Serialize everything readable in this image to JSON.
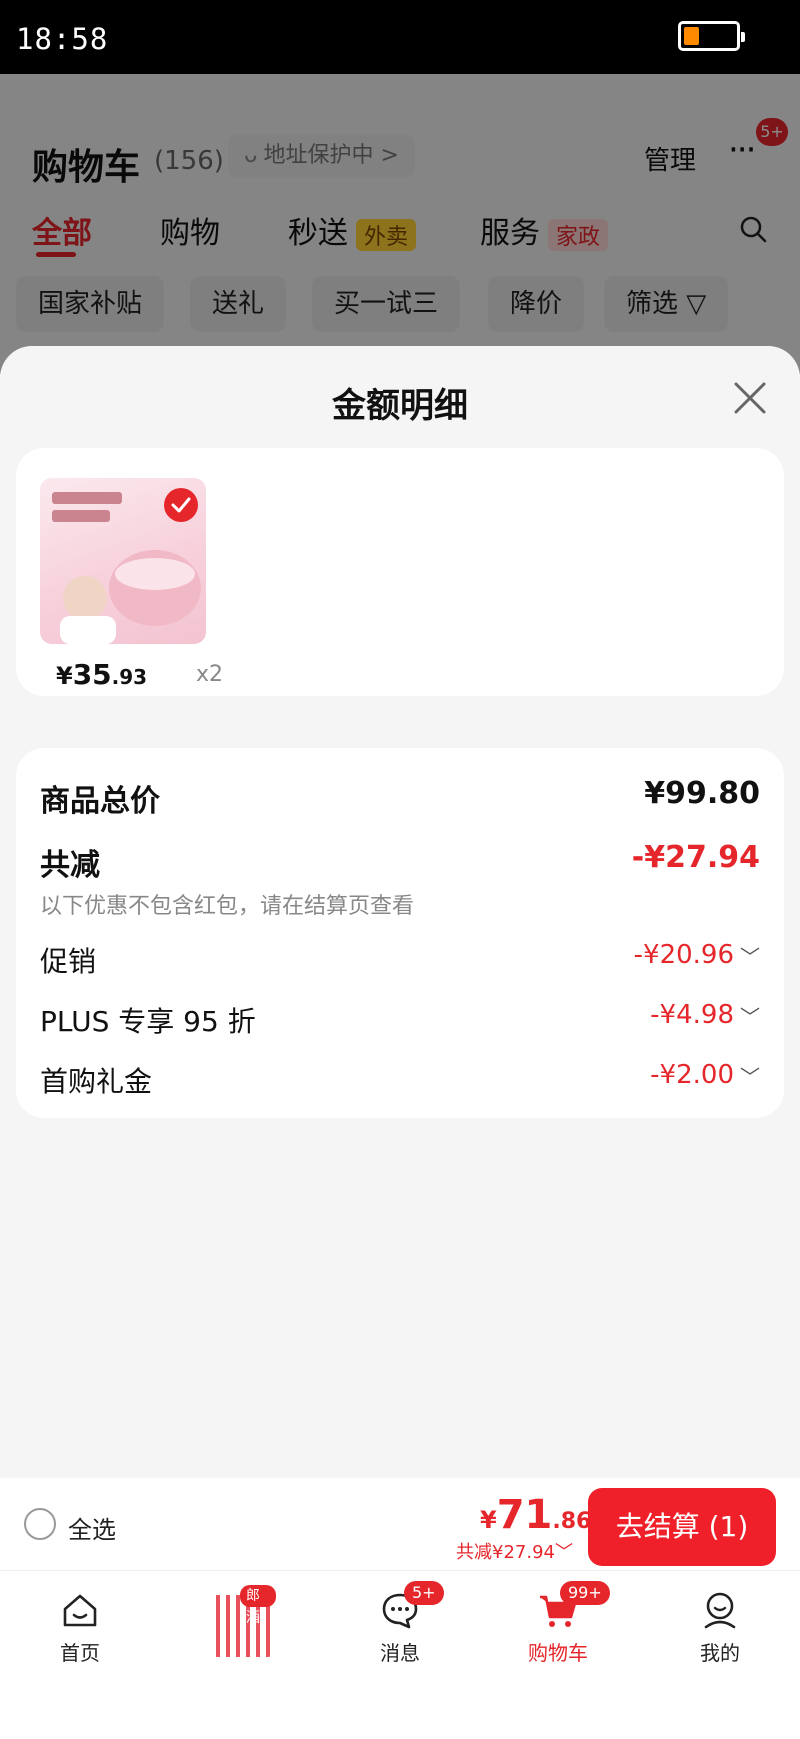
{
  "status_bar": {
    "time": "18:58",
    "battery_level": 0.3,
    "battery_color": "#ff8a00"
  },
  "cart_page": {
    "title": "购物车",
    "count": "(156)",
    "address_protection": "地址保护中 >",
    "manage": "管理",
    "more_badge": "5+",
    "tabs": [
      {
        "label": "全部",
        "active": true
      },
      {
        "label": "购物"
      },
      {
        "label": "秒送",
        "tag": "外卖"
      },
      {
        "label": "服务",
        "tag": "家政"
      }
    ],
    "chips": [
      "国家补贴",
      "送礼",
      "买一试三",
      "降价",
      "筛选"
    ]
  },
  "sheet": {
    "title": "金额明细",
    "item": {
      "image_icon": "product-thumbnail",
      "price_symbol": "¥",
      "price_int": "35",
      "price_dec": ".93",
      "quantity": "x2"
    },
    "total_label": "商品总价",
    "total_value": "¥99.80",
    "discount_label": "共减",
    "discount_value": "-¥27.94",
    "discount_note": "以下优惠不包含红包，请在结算页查看",
    "discounts": [
      {
        "label": "促销",
        "value": "-¥20.96"
      },
      {
        "label": "PLUS 专享 95 折",
        "value": "-¥4.98"
      },
      {
        "label": "首购礼金",
        "value": "-¥2.00"
      }
    ]
  },
  "checkout": {
    "select_all": "全选",
    "currency": "¥",
    "total_int": "71",
    "total_dec": ".86",
    "saved": "共减¥27.94",
    "pay_button": "去结算 (1)"
  },
  "nav": {
    "items": [
      {
        "label": "首页",
        "icon": "home-icon"
      },
      {
        "label": "",
        "icon": "promo-icon",
        "tag": "郎酒"
      },
      {
        "label": "消息",
        "icon": "message-icon",
        "badge": "5+"
      },
      {
        "label": "购物车",
        "icon": "cart-icon",
        "badge": "99+",
        "active": true
      },
      {
        "label": "我的",
        "icon": "profile-icon"
      }
    ]
  },
  "colors": {
    "accent": "#e5262b",
    "button": "#f0202a"
  }
}
